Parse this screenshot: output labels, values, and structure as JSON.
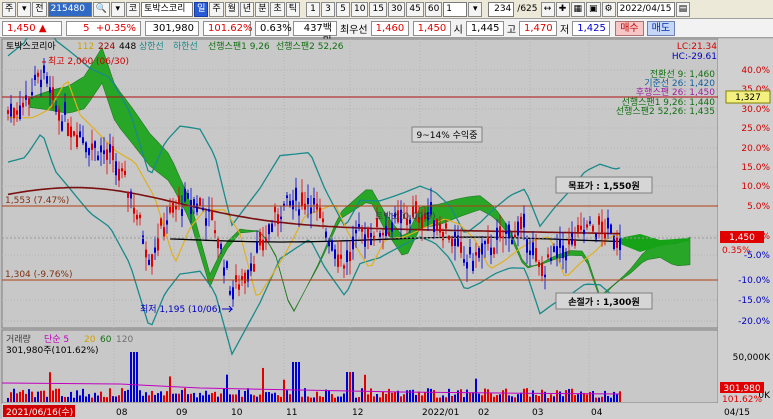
{
  "toolbar": {
    "market_label": "주",
    "type_label": "전",
    "code": "215480",
    "name_button": "코",
    "stock_name": "토박스코리",
    "periods": [
      "일",
      "주",
      "월",
      "년",
      "분",
      "초",
      "틱"
    ],
    "active_period": "일",
    "minutes": [
      "1",
      "3",
      "5",
      "10",
      "15",
      "30",
      "45",
      "60"
    ],
    "unit": "1",
    "count": "234",
    "total": "/625",
    "date": "2022/04/15"
  },
  "quote": {
    "price": "1,450",
    "change": "5",
    "change_pct": "+0.35%",
    "volume": "301,980",
    "volume_pct": "101.62%",
    "turnover_pct": "0.63%",
    "amount": "437백만",
    "best_label": "최우선",
    "ask": "1,460",
    "bid": "1,450",
    "open_label": "시",
    "open": "1,445",
    "high_label": "고",
    "high": "1,470",
    "low_label": "저",
    "low": "1,425",
    "buy_label": "매수",
    "sell_label": "매도"
  },
  "legend": {
    "name": "토박스코리아",
    "p1": "112",
    "p2": "224",
    "p3": "448",
    "upper": "상한선",
    "lower": "하한선",
    "span1": "선행스팬1 9,26",
    "span2": "선행스팬2 52,26"
  },
  "right_legend": {
    "lc": "LC:21.34",
    "hc": "HC:-29.61",
    "conv": "전환선 9: 1,460",
    "base": "기준선 26: 1,420",
    "lag": "후행스팬 26: 1,450",
    "s1": "선행스팬1 9,26: 1,440",
    "s2": "선행스팬2 52,26: 1,435"
  },
  "annotations": {
    "high_mark": "최고 2,060 (06/30)",
    "low_mark": "최저 1,195 (10/06)",
    "profit": "9~14% 수익중",
    "target": "목표가 : 1,550원",
    "stop": "손절가 : 1,300원",
    "upper_line": "1,553 (7.47%)",
    "lower_line": "1,304 (-9.76%)",
    "mid_line": "토박스(0.00%)"
  },
  "right_tags": {
    "price_tag": "1,327",
    "last_price": "1,450",
    "last_pct": "0.35%",
    "vol_tag": "301,980",
    "vol_pct": "101.62%"
  },
  "volume_legend": {
    "label": "거래량",
    "p1": "단순 5",
    "p2": "20",
    "p3": "60",
    "p4": "120",
    "value": "301,980주(101.62%)"
  },
  "axis": {
    "pct_ticks": [
      "40.0%",
      "35.0%",
      "30.0%",
      "25.0%",
      "20.0%",
      "15.0%",
      "10.0%",
      "5.0%",
      "0.35%",
      "-5.0%",
      "-10.0%",
      "-15.0%",
      "-20.0%"
    ],
    "vol_ticks": [
      "50,000K",
      "0K"
    ],
    "x_ticks": [
      "2021/06/16(수)",
      "08",
      "09",
      "10",
      "11",
      "12",
      "2022/01",
      "02",
      "03",
      "04",
      "04/15"
    ]
  },
  "colors": {
    "up": "#e00000",
    "down": "#0000d0",
    "cloud": "#17a317",
    "bollinger": "#1a8a8a",
    "ma_long": "#7a1010",
    "ma_mid": "#e0b020"
  }
}
